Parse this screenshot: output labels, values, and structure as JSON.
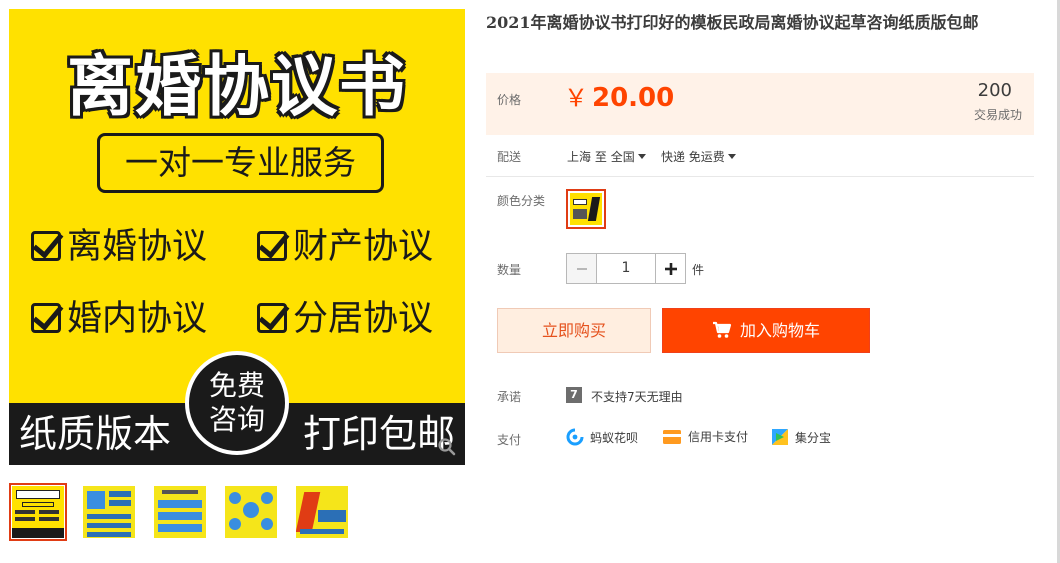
{
  "gallery": {
    "main_image": {
      "title": "离婚协议书",
      "box_text": "一对一专业服务",
      "features": [
        "离婚协议",
        "财产协议",
        "婚内协议",
        "分居协议"
      ],
      "bottom_left": "纸质版本",
      "circle_top": "免费",
      "circle_bottom": "咨询",
      "bottom_right": "打印包邮"
    },
    "thumbnails": [
      {
        "selected": true
      },
      {
        "selected": false
      },
      {
        "selected": false
      },
      {
        "selected": false
      },
      {
        "selected": false
      }
    ]
  },
  "product": {
    "title": "2021年离婚协议书打印好的模板民政局离婚协议起草咨询纸质版包邮",
    "price_label": "价格",
    "currency": "￥",
    "price": "20.00",
    "sales_count": "200",
    "sales_label": "交易成功",
    "delivery_label": "配送",
    "delivery_from": "上海",
    "delivery_to_word": "至",
    "delivery_dest": "全国",
    "delivery_method": "快递 免运费",
    "color_label": "颜色分类",
    "quantity_label": "数量",
    "quantity_value": "1",
    "quantity_unit": "件",
    "buy_now_label": "立即购买",
    "add_to_cart_label": "加入购物车",
    "promise_label": "承诺",
    "promise_badge": "7",
    "promise_text": "不支持7天无理由",
    "payment_label": "支付",
    "payment_methods": [
      "蚂蚁花呗",
      "信用卡支付",
      "集分宝"
    ]
  },
  "colors": {
    "accent": "#ff4400",
    "price_bg": "#fff2e8",
    "image_yellow": "#ffe100"
  }
}
